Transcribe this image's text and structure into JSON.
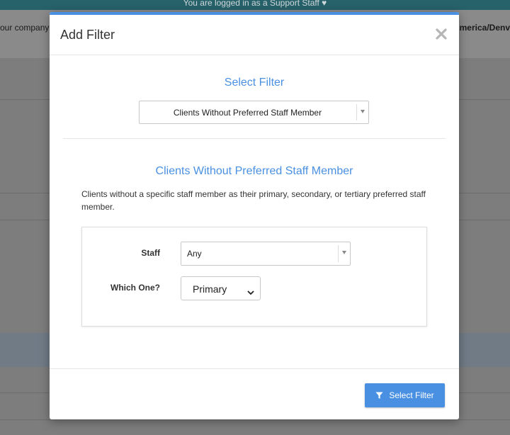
{
  "background": {
    "banner_text": "You are logged in as a Support Staff ♥",
    "left_text": "our company",
    "right_text": "America/Denv"
  },
  "modal": {
    "title": "Add Filter",
    "close_icon": "close-icon",
    "select_filter_heading": "Select Filter",
    "filter_select_value": "Clients Without Preferred Staff Member",
    "section_title": "Clients Without Preferred Staff Member",
    "description": "Clients without a specific staff member as their primary, secondary, or tertiary preferred staff member.",
    "form": {
      "staff_label": "Staff",
      "staff_value": "Any",
      "which_label": "Which One?",
      "which_value": "Primary"
    },
    "footer": {
      "button_label": "Select Filter",
      "button_icon": "filter-icon"
    },
    "accent_color": "#4a90e2"
  }
}
